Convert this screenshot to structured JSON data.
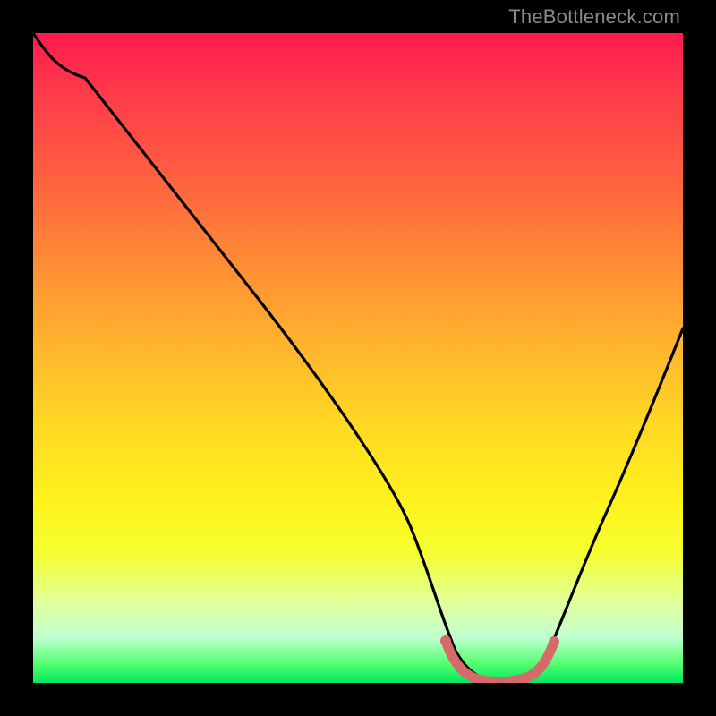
{
  "watermark": "TheBottleneck.com",
  "chart_data": {
    "type": "line",
    "title": "",
    "xlabel": "",
    "ylabel": "",
    "xlim": [
      0,
      100
    ],
    "ylim": [
      0,
      100
    ],
    "grid": false,
    "series": [
      {
        "name": "bottleneck-curve",
        "color": "#000000",
        "x": [
          0,
          3,
          8,
          20,
          35,
          50,
          58,
          62,
          65,
          68,
          72,
          75,
          78,
          80,
          85,
          92,
          100
        ],
        "y": [
          100,
          97,
          93,
          78,
          59,
          39,
          26,
          15,
          6,
          1.5,
          0.3,
          0.3,
          1.5,
          5,
          18,
          38,
          58
        ]
      },
      {
        "name": "optimal-zone-marker",
        "color": "#d46a6a",
        "type": "segment",
        "x": [
          63.5,
          66,
          70,
          74,
          77,
          79.5
        ],
        "y": [
          6.5,
          2,
          0.5,
          0.5,
          2.5,
          6.5
        ]
      }
    ],
    "background_gradient": {
      "top": "#ff1a4d",
      "mid": "#ffe020",
      "bottom": "#00e860"
    }
  }
}
